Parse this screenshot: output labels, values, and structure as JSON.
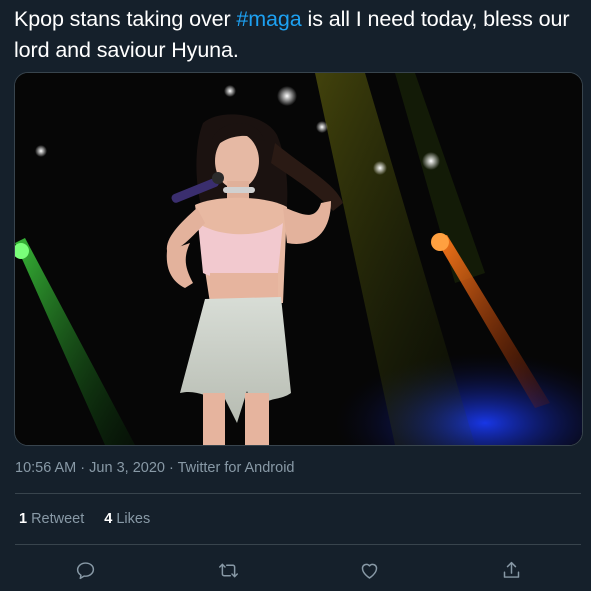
{
  "tweet": {
    "text_before": "Kpop stans taking over ",
    "hashtag": "#maga",
    "text_after": " is all I need today, bless our lord and saviour Hyuna.",
    "time": "10:56 AM",
    "date": "Jun 3, 2020",
    "source": "Twitter for Android",
    "separator": "·"
  },
  "stats": {
    "retweets_count": "1",
    "retweets_label": "Retweet",
    "likes_count": "4",
    "likes_label": "Likes"
  },
  "actions": [
    {
      "name": "reply",
      "icon": "reply-icon"
    },
    {
      "name": "retweet",
      "icon": "retweet-icon"
    },
    {
      "name": "like",
      "icon": "heart-icon"
    },
    {
      "name": "share",
      "icon": "share-icon"
    }
  ],
  "colors": {
    "background": "#15202b",
    "hashtag": "#1da1f2",
    "secondary_text": "#8899a6",
    "border": "#38444d"
  },
  "media": {
    "description_icon": "concert-photo"
  }
}
